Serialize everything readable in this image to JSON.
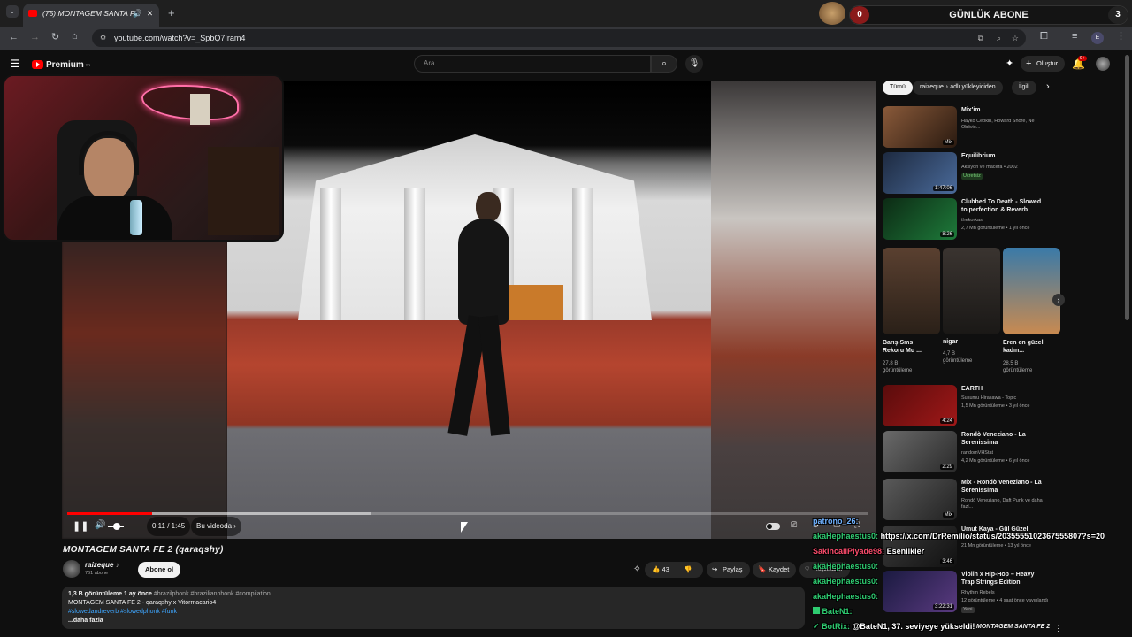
{
  "browser": {
    "tab_title": "(75) MONTAGEM SANTA F",
    "url": "youtube.com/watch?v=_SpbQ7Iram4",
    "profile_initial": "E"
  },
  "overlay_widget": {
    "left_count": "0",
    "label": "GÜNLÜK ABONE",
    "right_count": "3"
  },
  "youtube": {
    "logo": "Premium",
    "logo_sup": "TR",
    "search_placeholder": "Ara",
    "create_label": "Oluştur",
    "notif_count": "9+"
  },
  "player": {
    "time": "0:11 / 1:45",
    "chapter": "Bu videoda",
    "progress": 0.106,
    "buffered": 0.38,
    "watermark": "..."
  },
  "video": {
    "title": "MONTAGEM SANTA FE 2 (qaraqshy)",
    "channel": "raizeque",
    "channel_badge": "♪",
    "subscribers": "761 abone",
    "subscribe_label": "Abone ol",
    "like_count": "43",
    "share_label": "Paylaş",
    "save_label": "Kaydet",
    "thanks_label": "Teşekkürler",
    "desc_line1": "1,3 B görüntüleme  1 ay önce",
    "desc_tags1": "#brazilphonk #brazilianphonk #compilation",
    "desc_line2": "MONTAGEM SANTA FE 2 - qaraqshy x Vitormacario4",
    "desc_tags2": "#slowedandreverb #slowedphonk #funk",
    "desc_more": "...daha fazla"
  },
  "filters": {
    "all": "Tümü",
    "uploader": "raizeque ♪ adlı yükleyiciden",
    "related": "İlgili"
  },
  "recommendations": [
    {
      "title": "Mix'im",
      "meta1": "Hayko Cepkin, Howard Shore, Ne Oblivio...",
      "meta2": "",
      "duration": "Mix",
      "color": "#5a3a2a"
    },
    {
      "title": "Equilibrium",
      "meta1": "Aksiyon ve macera • 2002",
      "meta2": "Ücretsiz",
      "duration": "1:47:06",
      "color": "#1d2a40"
    },
    {
      "title": "Clubbed To Death - Slowed to perfection & Reverb",
      "meta1": "thekorkas",
      "meta2": "2,7 Mn görüntüleme • 1 yıl önce",
      "duration": "8:26",
      "color": "#0c2a14"
    },
    {
      "title": "EARTH",
      "meta1": "Susumu Hirasawa - Topic",
      "meta2": "1,5 Mn görüntüleme • 3 yıl önce",
      "duration": "4:24",
      "color": "#5a0c0c"
    },
    {
      "title": "Rondò Veneziano - La Serenissima",
      "meta1": "randomVHStat",
      "meta2": "4,2 Mn görüntüleme • 6 yıl önce",
      "duration": "2:29",
      "color": "#4a4a4a"
    },
    {
      "title": "Mix - Rondò Veneziano - La Serenissima",
      "meta1": "Rondò Veneziano, Daft Punk ve daha fazl...",
      "meta2": "",
      "duration": "Mix",
      "color": "#3a3a3a"
    },
    {
      "title": "Umut Kaya - Gül Güzeli",
      "meta1": "...",
      "meta2": "21 Mn görüntüleme • 13 yıl önce",
      "duration": "3:46",
      "color": "#2a2a2a"
    },
    {
      "title": "Violin x Hip-Hop – Heavy Trap Strings Edition",
      "meta1": "Rhythm Rebels",
      "meta2": "12 görüntüleme • 4 saat önce yayınlandı",
      "meta3": "Yeni",
      "duration": "3:22:31",
      "color": "#1a1a40"
    }
  ],
  "shorts": [
    {
      "title": "Barış Sms Rekoru Mu ...",
      "views": "27,8 B görüntüleme",
      "color": "#3a3028"
    },
    {
      "title": "nigar",
      "views": "4,7 B görüntüleme",
      "color": "#2a2622"
    },
    {
      "title": "Eren en güzel kadın...",
      "views": "28,5 B görüntüleme",
      "color": "#2a5a7a"
    }
  ],
  "last_item_title": "MONTAGEM SANTA FE 2",
  "chat": [
    {
      "user": "patrono_26:",
      "msg": "",
      "color": "#6fb1ff"
    },
    {
      "user": "akaHephaestus0:",
      "msg": "https://x.com/DrRemilio/status/2035555102367555807?s=20",
      "color": "#2ecc71"
    },
    {
      "user": "SakincaliPiyade98:",
      "msg": "Esenlikler",
      "color": "#ff4d6d"
    },
    {
      "user": "akaHephaestus0:",
      "msg": "",
      "color": "#2ecc71"
    },
    {
      "user": "akaHephaestus0:",
      "msg": "",
      "color": "#2ecc71"
    },
    {
      "user": "akaHephaestus0:",
      "msg": "",
      "color": "#2ecc71"
    },
    {
      "user": "BateN1:",
      "msg": "",
      "color": "#2ecc71"
    },
    {
      "user": "BotRix:",
      "msg": "@BateN1, 37. seviyeye yükseldi!",
      "color": "#2ecc71"
    }
  ]
}
